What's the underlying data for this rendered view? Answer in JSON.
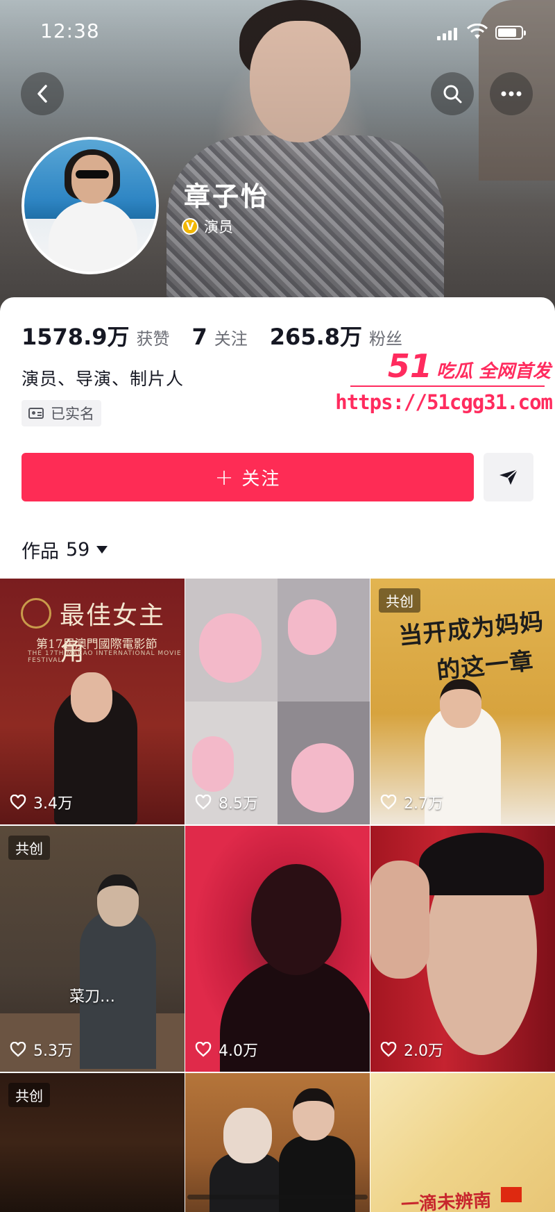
{
  "status_bar": {
    "time": "12:38"
  },
  "profile": {
    "name": "章子怡",
    "verified_badge": "V",
    "verified_label": "演员",
    "stats": [
      {
        "value": "1578.9万",
        "label": "获赞"
      },
      {
        "value": "7",
        "label": "关注"
      },
      {
        "value": "265.8万",
        "label": "粉丝"
      }
    ],
    "bio": "演员、导演、制片人",
    "realname_tag": "已实名",
    "follow_plus": "+",
    "follow_label": "关注"
  },
  "works": {
    "label": "作品",
    "count": "59"
  },
  "watermark": {
    "prefix": "51",
    "text": "吃瓜 全网首发",
    "url": "https://51cgg31.com"
  },
  "videos": [
    {
      "likes": "3.4万",
      "title": "最佳女主角",
      "subtitle": "第17屆澳門國際電影節",
      "subsubtitle": "THE 17TH MACAO INTERNATIONAL MOVIE FESTIVAL"
    },
    {
      "likes": "8.5万"
    },
    {
      "likes": "2.7万",
      "badge": "共创",
      "headline_1": "当开成为妈妈",
      "headline_2": "的这一章"
    },
    {
      "likes": "5.3万",
      "badge": "共创",
      "caption": "菜刀…"
    },
    {
      "likes": "4.0万"
    },
    {
      "likes": "2.0万"
    },
    {
      "badge": "共创"
    },
    {},
    {
      "caption": "一滴未辨南"
    }
  ],
  "colors": {
    "accent": "#fe2c55",
    "watermark": "#ff2b5e"
  }
}
